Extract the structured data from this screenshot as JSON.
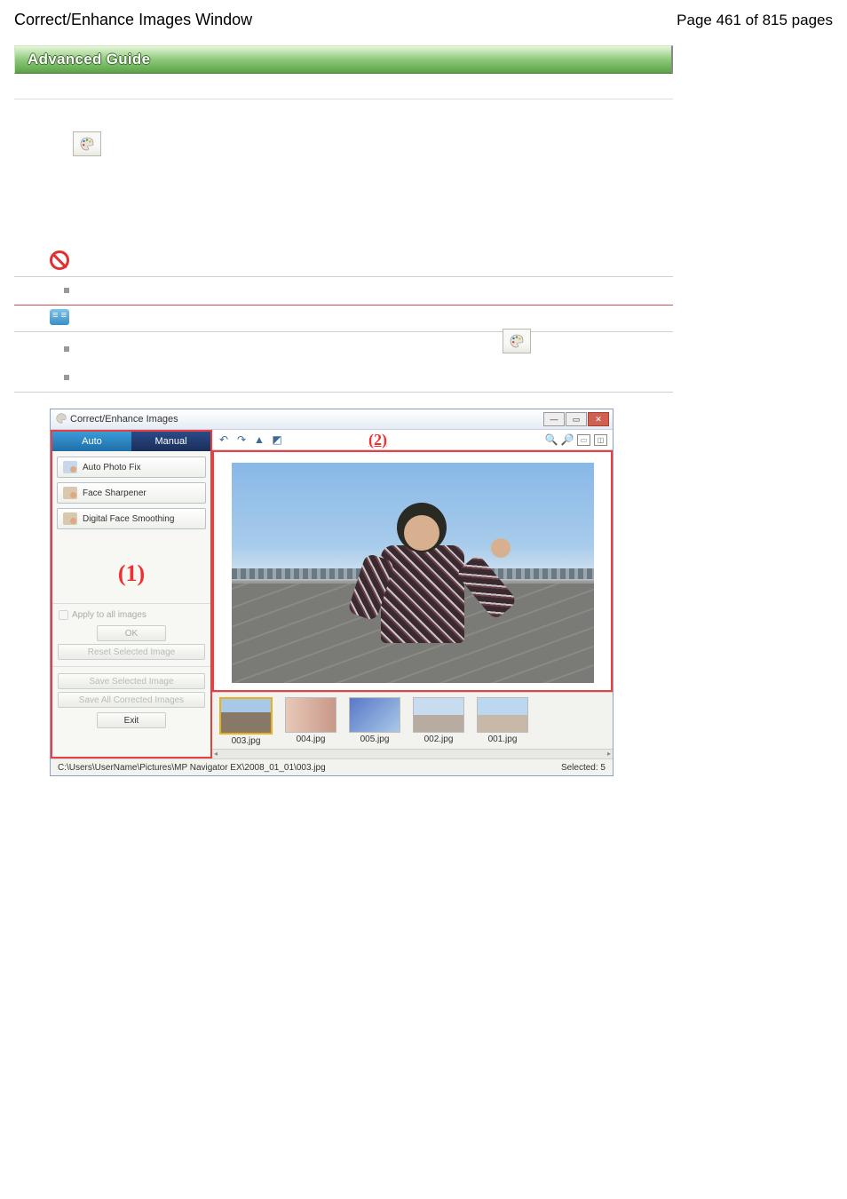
{
  "header": {
    "title": "Correct/Enhance Images Window",
    "page_label": "Page 461 of 815 pages"
  },
  "banner": "Advanced Guide",
  "window": {
    "title": "Correct/Enhance Images",
    "tabs": {
      "auto": "Auto",
      "manual": "Manual"
    },
    "fx": {
      "auto_photo_fix": "Auto Photo Fix",
      "face_sharpener": "Face Sharpener",
      "digital_face_smoothing": "Digital Face Smoothing"
    },
    "region1": "(1)",
    "region2": "(2)",
    "apply_all": "Apply to all images",
    "ok": "OK",
    "reset": "Reset Selected Image",
    "save_sel": "Save Selected Image",
    "save_all": "Save All Corrected Images",
    "exit": "Exit",
    "thumbs": [
      "003.jpg",
      "004.jpg",
      "005.jpg",
      "002.jpg",
      "001.jpg"
    ],
    "status_path": "C:\\Users\\UserName\\Pictures\\MP Navigator EX\\2008_01_01\\003.jpg",
    "status_selected": "Selected: 5"
  }
}
